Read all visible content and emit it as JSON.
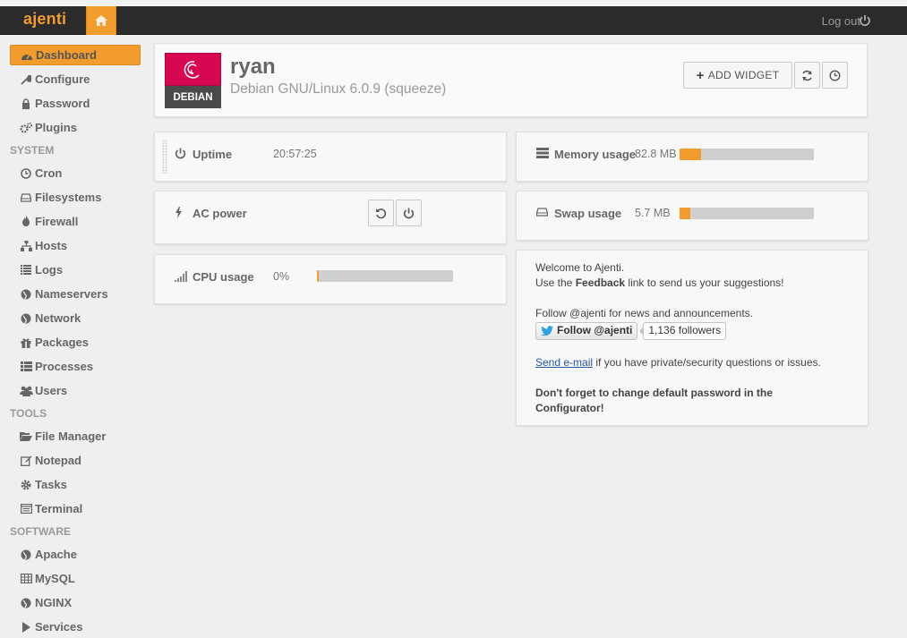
{
  "app": {
    "brand": "ajenti",
    "logout_label": "Log out",
    "accent_color": "#f19c2d"
  },
  "sidebar": {
    "items": [
      {
        "label": "Dashboard",
        "icon": "dashboard-icon",
        "active": true
      },
      {
        "label": "Configure",
        "icon": "wrench-icon"
      },
      {
        "label": "Password",
        "icon": "lock-icon"
      },
      {
        "label": "Plugins",
        "icon": "cogs-icon"
      }
    ],
    "sections": [
      {
        "title": "SYSTEM",
        "items": [
          {
            "label": "Cron",
            "icon": "clock-icon"
          },
          {
            "label": "Filesystems",
            "icon": "hdd-icon"
          },
          {
            "label": "Firewall",
            "icon": "fire-icon"
          },
          {
            "label": "Hosts",
            "icon": "sitemap-icon"
          },
          {
            "label": "Logs",
            "icon": "list-icon"
          },
          {
            "label": "Nameservers",
            "icon": "globe-icon"
          },
          {
            "label": "Network",
            "icon": "globe-icon"
          },
          {
            "label": "Packages",
            "icon": "gift-icon"
          },
          {
            "label": "Processes",
            "icon": "th-list-icon"
          },
          {
            "label": "Users",
            "icon": "group-icon"
          }
        ]
      },
      {
        "title": "TOOLS",
        "items": [
          {
            "label": "File Manager",
            "icon": "folder-open-icon"
          },
          {
            "label": "Notepad",
            "icon": "edit-icon"
          },
          {
            "label": "Tasks",
            "icon": "cog-icon"
          },
          {
            "label": "Terminal",
            "icon": "terminal-icon"
          }
        ]
      },
      {
        "title": "SOFTWARE",
        "items": [
          {
            "label": "Apache",
            "icon": "globe-icon"
          },
          {
            "label": "MySQL",
            "icon": "table-icon"
          },
          {
            "label": "NGINX",
            "icon": "globe-icon"
          },
          {
            "label": "Services",
            "icon": "play-icon"
          }
        ]
      }
    ]
  },
  "header": {
    "hostname": "ryan",
    "os": "Debian GNU/Linux 6.0.9 (squeeze)",
    "distro_badge": "DEBIAN",
    "add_widget_label": "ADD WIDGET"
  },
  "widgets": {
    "uptime": {
      "label": "Uptime",
      "value": "20:57:25"
    },
    "power": {
      "label": "AC power"
    },
    "cpu": {
      "label": "CPU usage",
      "value": "0%",
      "fraction": 0.0
    },
    "memory": {
      "label": "Memory usage",
      "value": "82.8 MB",
      "fraction": 0.16
    },
    "swap": {
      "label": "Swap usage",
      "value": "5.7 MB",
      "fraction": 0.08
    }
  },
  "welcome": {
    "line1": "Welcome to Ajenti.",
    "line2_pre": "Use the ",
    "line2_bold": "Feedback",
    "line2_post": " link to send us your suggestions!",
    "follow_text": "Follow @ajenti for news and announcements.",
    "twitter_button": "Follow @ajenti",
    "followers": "1,136 followers",
    "email_link": "Send e-mail",
    "email_post": " if you have private/security questions or issues.",
    "warning": "Don't forget to change default password in the Configurator!"
  }
}
